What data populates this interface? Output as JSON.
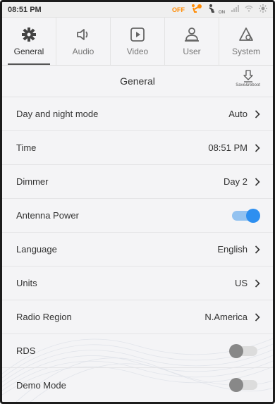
{
  "status": {
    "time": "08:51 PM",
    "airbag_label": "OFF",
    "belt_label": "ON"
  },
  "tabs": [
    {
      "label": "General",
      "icon": "gear-icon",
      "active": true
    },
    {
      "label": "Audio",
      "icon": "speaker-icon",
      "active": false
    },
    {
      "label": "Video",
      "icon": "play-icon",
      "active": false
    },
    {
      "label": "User",
      "icon": "user-icon",
      "active": false
    },
    {
      "label": "System",
      "icon": "system-gear-icon",
      "active": false
    }
  ],
  "header": {
    "title": "General",
    "save_label": "Save&reboot"
  },
  "settings": [
    {
      "label": "Day and night mode",
      "value": "Auto",
      "type": "select"
    },
    {
      "label": "Time",
      "value": "08:51 PM",
      "type": "select"
    },
    {
      "label": "Dimmer",
      "value": "Day 2",
      "type": "select"
    },
    {
      "label": "Antenna Power",
      "type": "toggle",
      "on": true
    },
    {
      "label": "Language",
      "value": "English",
      "type": "select"
    },
    {
      "label": "Units",
      "value": "US",
      "type": "select"
    },
    {
      "label": "Radio Region",
      "value": "N.America",
      "type": "select"
    },
    {
      "label": "RDS",
      "type": "toggle",
      "on": false
    },
    {
      "label": "Demo Mode",
      "type": "toggle",
      "on": false
    }
  ],
  "colors": {
    "accent": "#2d8ff0",
    "airbag": "#ff8a00"
  }
}
